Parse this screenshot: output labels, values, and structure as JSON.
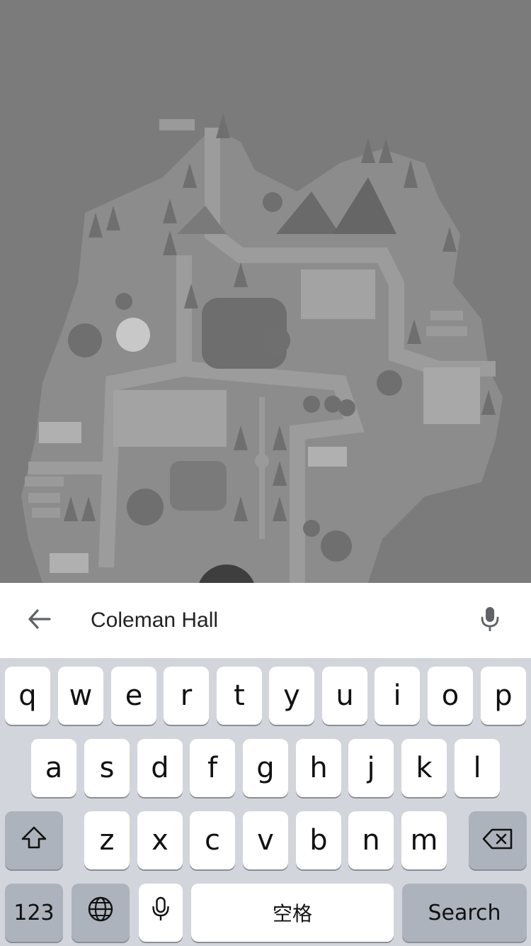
{
  "search": {
    "value": "Coleman Hall",
    "back_icon": "arrow-left-icon",
    "mic_icon": "microphone-icon"
  },
  "keyboard": {
    "row1": [
      "q",
      "w",
      "e",
      "r",
      "t",
      "y",
      "u",
      "i",
      "o",
      "p"
    ],
    "row2": [
      "a",
      "s",
      "d",
      "f",
      "g",
      "h",
      "j",
      "k",
      "l"
    ],
    "row3": [
      "z",
      "x",
      "c",
      "v",
      "b",
      "n",
      "m"
    ],
    "shift_icon": "shift-arrow-icon",
    "delete_icon": "backspace-icon",
    "numbers_label": "123",
    "globe_icon": "globe-icon",
    "dictation_icon": "microphone-icon",
    "space_label": "空格",
    "search_label": "Search"
  },
  "colors": {
    "map_overlay": "#7b7b7b",
    "search_bar_bg": "#ffffff",
    "keyboard_bg": "#d2d5db",
    "key_bg": "#ffffff",
    "function_key_bg": "#adb3bc"
  }
}
